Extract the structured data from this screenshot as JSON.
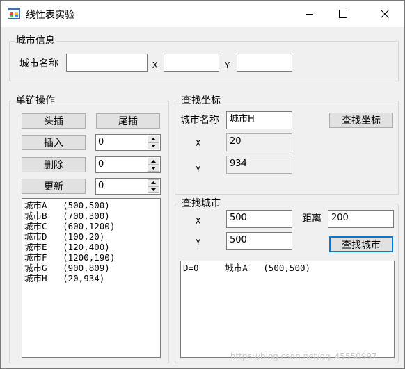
{
  "window": {
    "title": "线性表实验"
  },
  "city_info": {
    "title": "城市信息",
    "name_label": "城市名称",
    "name_value": "",
    "x_label": "X",
    "x_value": "",
    "y_label": "Y",
    "y_value": ""
  },
  "linked_ops": {
    "title": "单链操作",
    "head_insert": "头插",
    "tail_insert": "尾插",
    "insert": "插入",
    "delete": "删除",
    "update": "更新",
    "insert_index": "0",
    "delete_index": "0",
    "update_index": "0",
    "city_list": [
      "城市A   (500,500)",
      "城市B   (700,300)",
      "城市C   (600,1200)",
      "城市D   (100,20)",
      "城市E   (120,400)",
      "城市F   (1200,190)",
      "城市G   (900,809)",
      "城市H   (20,934)"
    ]
  },
  "find_coord": {
    "title": "查找坐标",
    "name_label": "城市名称",
    "name_value": "城市H",
    "button": "查找坐标",
    "x_label": "X",
    "x_value": "20",
    "y_label": "Y",
    "y_value": "934"
  },
  "find_city": {
    "title": "查找城市",
    "x_label": "X",
    "x_value": "500",
    "y_label": "Y",
    "y_value": "500",
    "distance_label": "距离",
    "distance_value": "200",
    "button": "查找城市",
    "results": [
      "D=0     城市A   (500,500)"
    ]
  },
  "watermark": "https://blog.csdn.net/qq_45550997"
}
